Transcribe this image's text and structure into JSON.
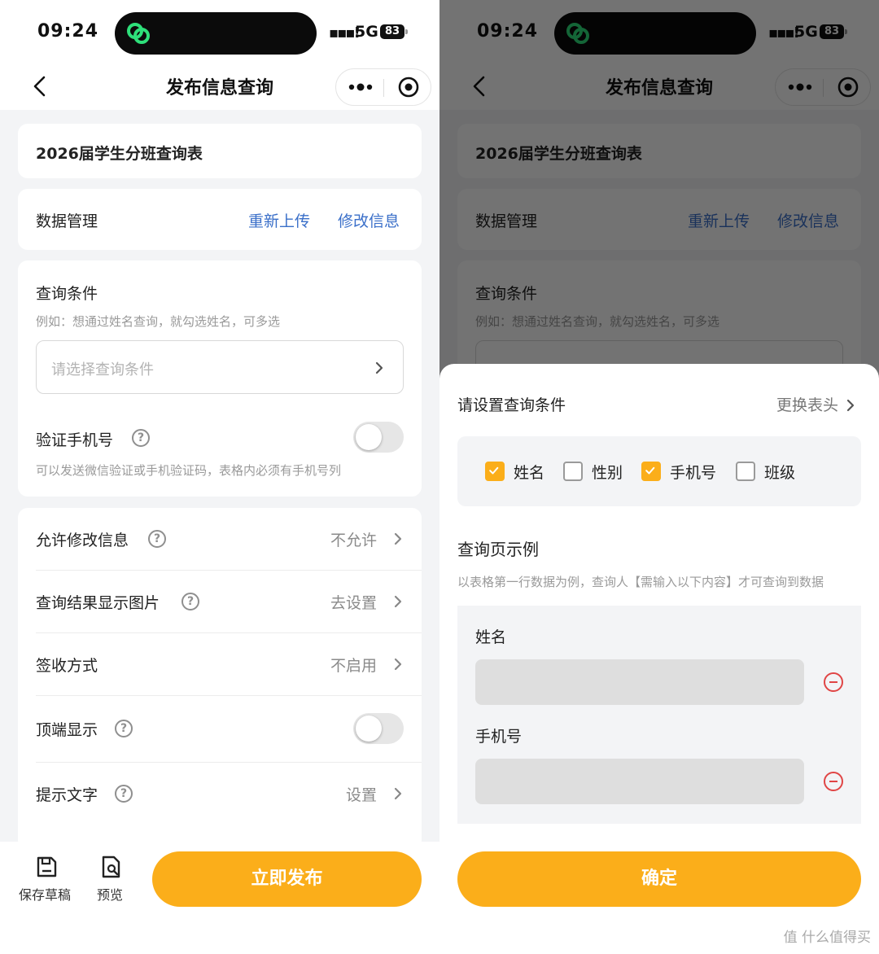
{
  "status": {
    "time": "09:24",
    "network": "5G",
    "battery": "83"
  },
  "nav": {
    "title": "发布信息查询"
  },
  "form": {
    "table_title": "2026届学生分班查询表",
    "data_manage": {
      "label": "数据管理",
      "reupload": "重新上传",
      "edit": "修改信息"
    },
    "query": {
      "title": "查询条件",
      "hint": "例如：想通过姓名查询，就勾选姓名，可多选",
      "placeholder": "请选择查询条件"
    },
    "verify": {
      "label": "验证手机号",
      "hint": "可以发送微信验证或手机验证码，表格内必须有手机号列",
      "enabled": false
    },
    "settings": [
      {
        "label": "允许修改信息",
        "value": "不允许",
        "help": true
      },
      {
        "label": "查询结果显示图片",
        "value": "去设置",
        "help": true
      },
      {
        "label": "签收方式",
        "value": "不启用",
        "help": false
      },
      {
        "label": "顶端显示",
        "value": "",
        "help": true,
        "toggle": false
      },
      {
        "label": "提示文字",
        "value": "设置",
        "help": true
      }
    ]
  },
  "bottom": {
    "save_draft": "保存草稿",
    "preview": "预览",
    "publish": "立即发布"
  },
  "sheet": {
    "title": "请设置查询条件",
    "switch_header": "更换表头",
    "options": [
      {
        "label": "姓名",
        "checked": true
      },
      {
        "label": "性别",
        "checked": false
      },
      {
        "label": "手机号",
        "checked": true
      },
      {
        "label": "班级",
        "checked": false
      }
    ],
    "example_title": "查询页示例",
    "example_hint": "以表格第一行数据为例，查询人【需输入以下内容】才可查询到数据",
    "fields": [
      "姓名",
      "手机号"
    ],
    "confirm": "确定"
  },
  "watermark": "值 什么值得买",
  "colors": {
    "accent": "#fbae1a",
    "link": "#3a6fc9",
    "danger": "#e04545"
  }
}
